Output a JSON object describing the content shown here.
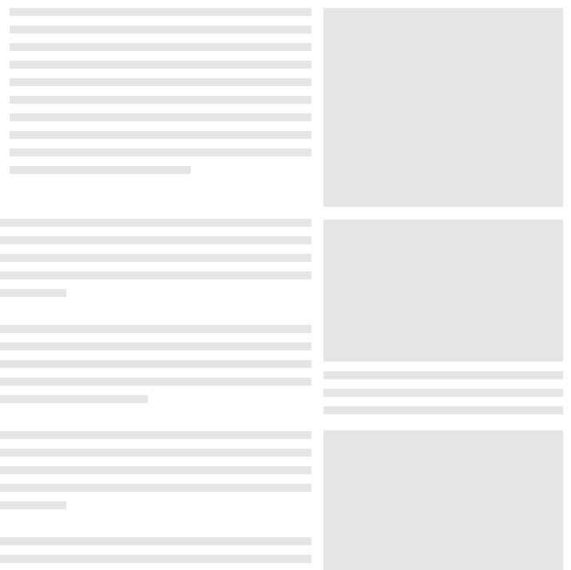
{
  "colors": {
    "background": "#ffffff",
    "placeholder": "#e5e5e5"
  }
}
